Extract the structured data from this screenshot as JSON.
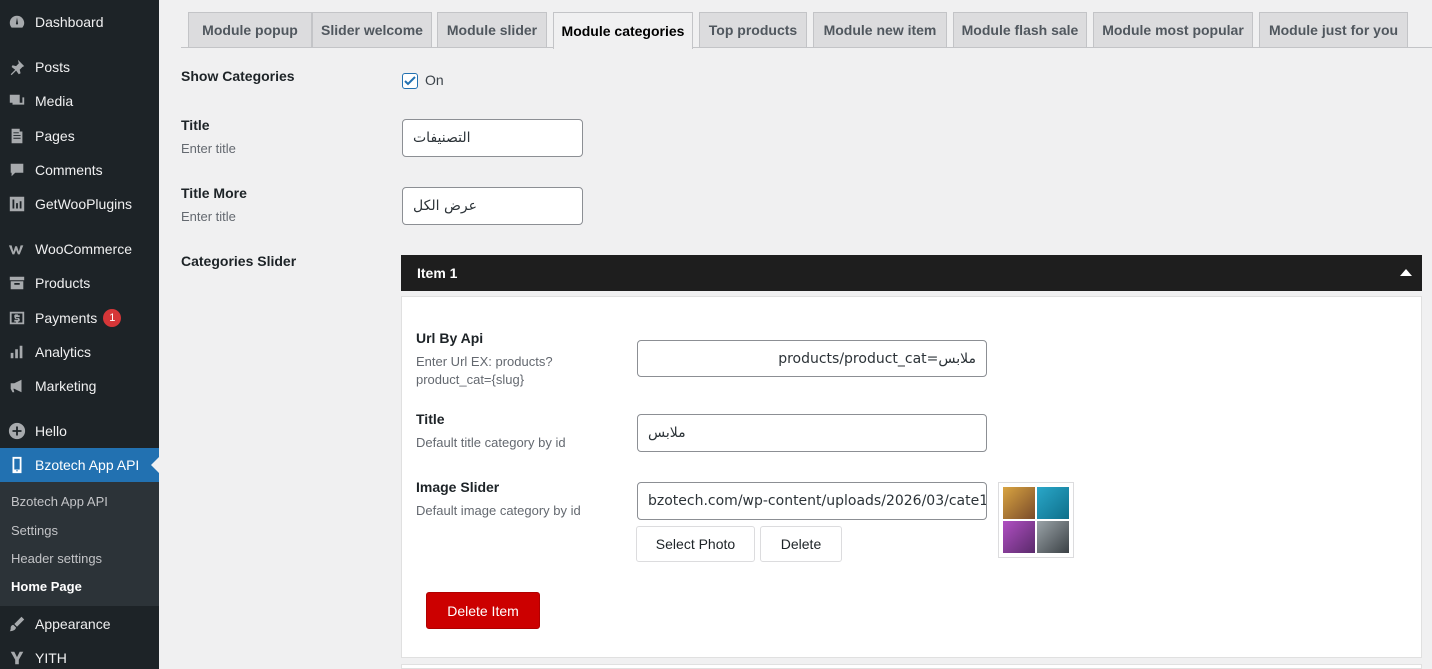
{
  "sidebar": {
    "items": [
      {
        "label": "Dashboard",
        "icon": "dashboard-icon"
      },
      {
        "label": "Posts",
        "icon": "pin-icon"
      },
      {
        "label": "Media",
        "icon": "media-icon"
      },
      {
        "label": "Pages",
        "icon": "pages-icon"
      },
      {
        "label": "Comments",
        "icon": "comment-icon"
      },
      {
        "label": "GetWooPlugins",
        "icon": "plugin-icon"
      },
      {
        "label": "WooCommerce",
        "icon": "woo-icon"
      },
      {
        "label": "Products",
        "icon": "archive-icon"
      },
      {
        "label": "Payments",
        "icon": "payments-icon",
        "badge": "1"
      },
      {
        "label": "Analytics",
        "icon": "chart-icon"
      },
      {
        "label": "Marketing",
        "icon": "megaphone-icon"
      },
      {
        "label": "Hello",
        "icon": "plus-circle-icon"
      },
      {
        "label": "Bzotech App API",
        "icon": "phone-icon"
      },
      {
        "label": "Appearance",
        "icon": "brush-icon"
      },
      {
        "label": "YITH",
        "icon": "yith-icon"
      }
    ],
    "submenu": [
      "Bzotech App API",
      "Settings",
      "Header settings",
      "Home Page"
    ]
  },
  "tabs": [
    "Module popup",
    "Slider welcome",
    "Module slider",
    "Module categories",
    "Top products",
    "Module new item",
    "Module flash sale",
    "Module most popular",
    "Module just for you"
  ],
  "form": {
    "show_categories": {
      "label": "Show Categories",
      "checkbox_label": "On",
      "checked": true
    },
    "title": {
      "label": "Title",
      "desc": "Enter title",
      "value": "التصنيفات"
    },
    "title_more": {
      "label": "Title More",
      "desc": "Enter title",
      "value": "عرض الكل"
    },
    "categories_slider": {
      "label": "Categories Slider"
    }
  },
  "item": {
    "header": "Item 1",
    "url": {
      "label": "Url By Api",
      "desc_line1": "Enter Url EX: products?",
      "desc_line2": "product_cat={slug}",
      "value": "products/product_cat=ملابس"
    },
    "title": {
      "label": "Title",
      "desc": "Default title category by id",
      "value": "ملابس"
    },
    "image": {
      "label": "Image Slider",
      "desc": "Default image category by id",
      "value": "bzotech.com/wp-content/uploads/2026/03/cate1.jpg"
    },
    "select_photo": "Select Photo",
    "delete": "Delete",
    "delete_item": "Delete Item"
  },
  "colors": {
    "sidebar_bg": "#1d2327",
    "active": "#2271b1",
    "danger": "#cc0000",
    "badge": "#d63638"
  }
}
